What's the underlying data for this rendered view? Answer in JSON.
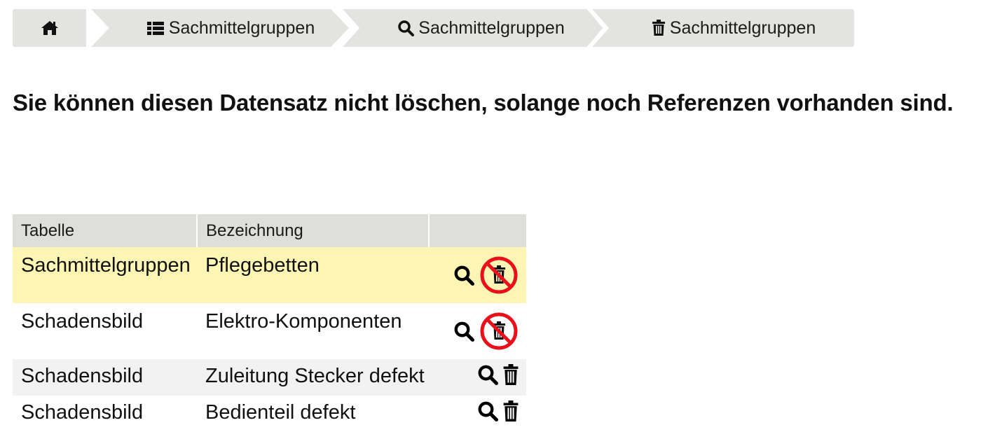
{
  "breadcrumb": {
    "items": [
      {
        "icon": "home-icon",
        "label": ""
      },
      {
        "icon": "list-icon",
        "label": "Sachmittelgruppen"
      },
      {
        "icon": "search-icon",
        "label": "Sachmittelgruppen"
      },
      {
        "icon": "trash-icon",
        "label": "Sachmittelgruppen"
      }
    ]
  },
  "message": "Sie können diesen Datensatz nicht löschen, solange noch Referenzen vorhanden sind.",
  "table": {
    "headers": [
      "Tabelle",
      "Bezeichnung",
      ""
    ],
    "rows": [
      {
        "tabelle": "Sachmittelgruppen",
        "bezeichnung": "Pflegebetten",
        "delete_blocked": true,
        "highlighted": true
      },
      {
        "tabelle": "Schadensbild",
        "bezeichnung": "Elektro-Komponenten",
        "delete_blocked": true,
        "highlighted": false
      },
      {
        "tabelle": "Schadensbild",
        "bezeichnung": "Zuleitung Stecker defekt",
        "delete_blocked": false,
        "highlighted": false
      },
      {
        "tabelle": "Schadensbild",
        "bezeichnung": "Bedienteil defekt",
        "delete_blocked": false,
        "highlighted": false
      }
    ]
  },
  "colors": {
    "crumb_bg": "#e3e3e0",
    "header_bg": "#dededb",
    "highlight_row": "#fdf5b4",
    "alt_row": "#f2f2f2",
    "blocked_red": "#e8101a"
  }
}
